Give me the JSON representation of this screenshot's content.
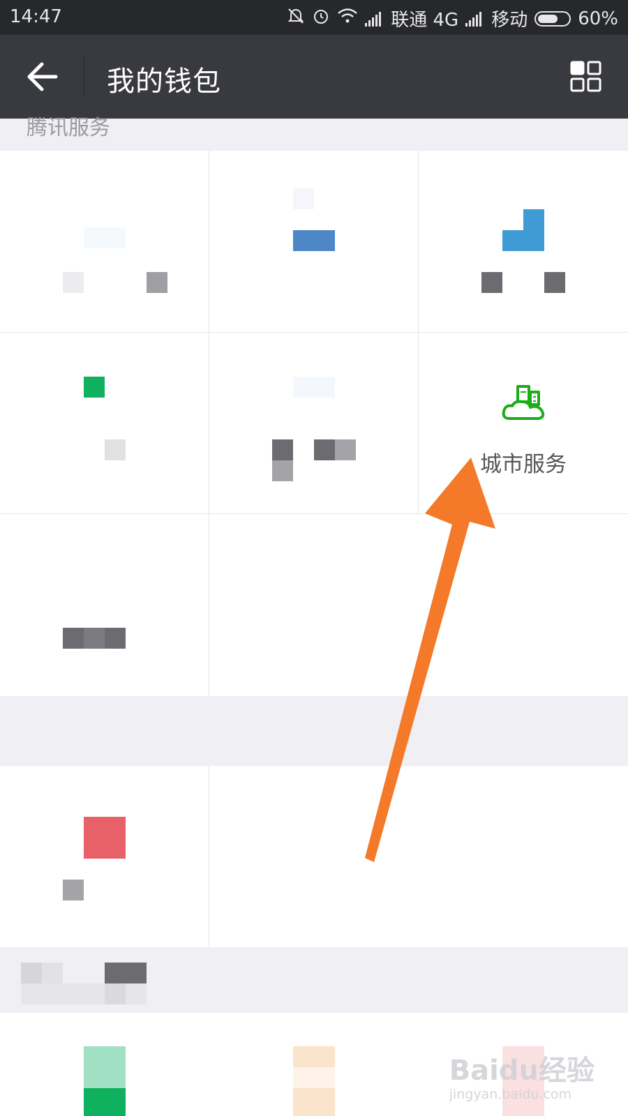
{
  "status_bar": {
    "time": "14:47",
    "carrier1": "联通 4G",
    "carrier2": "移动",
    "battery": "60%",
    "icons": [
      "mute-bell-icon",
      "alarm-icon",
      "wifi-icon",
      "signal-icon",
      "signal-icon",
      "battery-icon"
    ]
  },
  "header": {
    "title": "我的钱包",
    "back_icon": "arrow-left-icon",
    "menu_icon": "grid-icon"
  },
  "section": {
    "title": "腾讯服务"
  },
  "services": {
    "city_service": {
      "label": "城市服务",
      "icon": "city-cloud-icon",
      "color": "#1aad19"
    }
  },
  "annotation": {
    "arrow_color": "#f47929"
  },
  "watermark": {
    "logo": "Baidu经验",
    "sub": "jingyan.baidu.com"
  }
}
